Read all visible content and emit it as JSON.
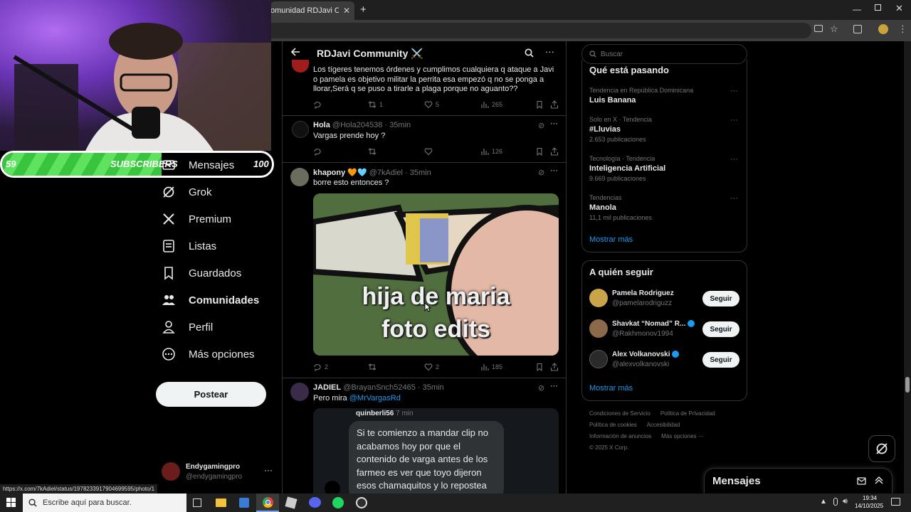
{
  "browser": {
    "tab_title": "omunidad RDJavi Communi",
    "status_url": "https://x.com/7kAdiel/status/1978233917904699595/photo/1"
  },
  "stream_overlay": {
    "sub_current": "59",
    "sub_label": "SUBSCRIBERS",
    "sub_goal": "100",
    "sub_progress": 0.59
  },
  "nav": {
    "items": [
      {
        "label": "Mensajes",
        "icon": "mail-icon"
      },
      {
        "label": "Grok",
        "icon": "grok-icon"
      },
      {
        "label": "Premium",
        "icon": "x-logo-icon"
      },
      {
        "label": "Listas",
        "icon": "list-icon"
      },
      {
        "label": "Guardados",
        "icon": "bookmark-icon"
      },
      {
        "label": "Comunidades",
        "icon": "communities-icon"
      },
      {
        "label": "Perfil",
        "icon": "person-icon"
      },
      {
        "label": "Más opciones",
        "icon": "more-circle-icon"
      }
    ],
    "post_label": "Postear",
    "account": {
      "name": "Endygamingpro",
      "handle": "@endygamingpro"
    }
  },
  "community": {
    "title": "RDJavi Community ⚔️"
  },
  "tweets": [
    {
      "text": "Los tígeres tenemos órdenes y cumplimos cualquiera q ataque a Javi o pamela es objetivo militar la perrita esa empezó q no se ponga a llorar,Será q se puso a tirarle a plaga porque no aguanto??",
      "replies": "",
      "retweets": "1",
      "likes": "5",
      "views": "265"
    },
    {
      "name": "Hola",
      "handle": "@Hola204538",
      "time": "· 35min",
      "text": "Vargas prende hoy ?",
      "replies": "",
      "retweets": "",
      "likes": "",
      "views": "126"
    },
    {
      "name": "khapony 🧡🩵",
      "handle": "@7kAdiel",
      "time": "· 35min",
      "text": "borre esto entonces ?",
      "image_caption": "hija de maria foto edits",
      "replies": "2",
      "retweets": "",
      "likes": "2",
      "views": "185"
    },
    {
      "name": "JADIEL",
      "handle": "@BrayanSnch52465",
      "time": "· 35min",
      "text_prefix": "Pero mira",
      "mention": "@MrVargasRd",
      "quote": {
        "name": "quinberli56",
        "time": "7 min",
        "text": "Si te comienzo a mandar clip no acabamos hoy por que el contenido de varga antes de los farmeo es ver que toyo dijeron esos chamaquitos y lo repostea"
      }
    }
  ],
  "search": {
    "placeholder": "Buscar"
  },
  "trends": {
    "title": "Qué está pasando",
    "items": [
      {
        "meta": "Tendencia en República Dominicana",
        "name": "Luis Banana",
        "count": ""
      },
      {
        "meta": "Solo en X · Tendencia",
        "name": "#Lluvias",
        "count": "2.653 publicaciones"
      },
      {
        "meta": "Tecnología · Tendencia",
        "name": "Inteligencia Artificial",
        "count": "9.669 publicaciones"
      },
      {
        "meta": "Tendencias",
        "name": "Manola",
        "count": "11,1 mil publicaciones"
      }
    ],
    "more": "Mostrar más"
  },
  "who_to_follow": {
    "title": "A quién seguir",
    "users": [
      {
        "name": "Pamela Rodriguez",
        "handle": "@pamelarodriguzz",
        "verified": false
      },
      {
        "name": "Shavkat “Nomad” R...",
        "handle": "@Rakhmonov1994",
        "verified": true
      },
      {
        "name": "Alex Volkanovski",
        "handle": "@alexvolkanovski",
        "verified": true
      }
    ],
    "follow_label": "Seguir",
    "more": "Mostrar más"
  },
  "footer": {
    "links": [
      "Condiciones de Servicio",
      "Política de Privacidad",
      "Política de cookies",
      "Accesibilidad",
      "Información de anuncios",
      "Más opciones ···"
    ],
    "copyright": "© 2025 X Corp."
  },
  "messages_dock": {
    "title": "Mensajes"
  },
  "taskbar": {
    "search_placeholder": "Escribe aquí para buscar.",
    "time": "19:34",
    "date": "14/10/2025"
  },
  "colors": {
    "accent": "#1d9bf0",
    "background": "#000000",
    "text": "#e7e9ea",
    "muted": "#71767b",
    "sub_bar": "#39c43f"
  }
}
